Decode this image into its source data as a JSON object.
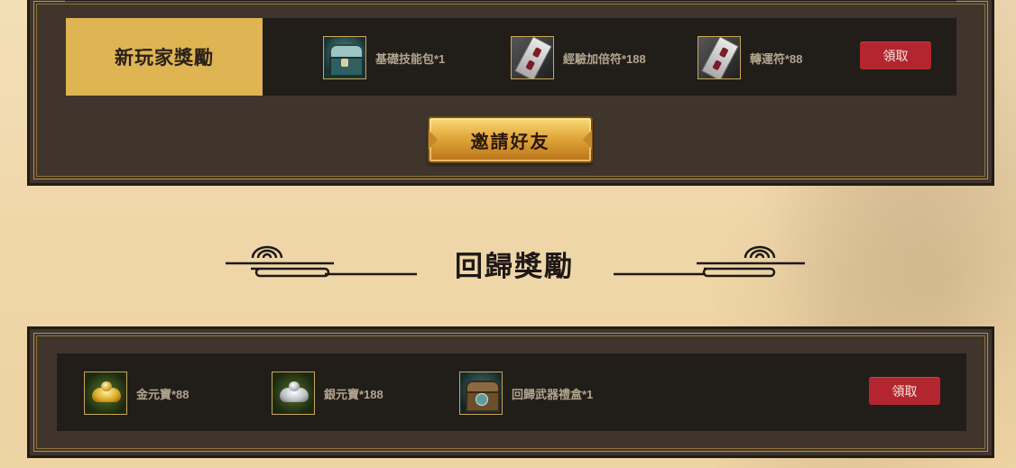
{
  "newplayer_reward": {
    "label": "新玩家獎勵",
    "items": [
      {
        "label": "基礎技能包*1",
        "icon": "skill-chest-icon"
      },
      {
        "label": "經驗加倍符*188",
        "icon": "exp-talisman-icon"
      },
      {
        "label": "轉運符*88",
        "icon": "luck-talisman-icon"
      }
    ],
    "claim_label": "領取"
  },
  "invite": {
    "label": "邀請好友"
  },
  "return_section": {
    "title": "回歸獎勵"
  },
  "return_reward": {
    "items": [
      {
        "label": "金元寶*88",
        "icon": "gold-ingot-icon"
      },
      {
        "label": "銀元寶*188",
        "icon": "silver-ingot-icon"
      },
      {
        "label": "回歸武器禮盒*1",
        "icon": "weapon-giftbox-icon"
      }
    ],
    "claim_label": "領取"
  },
  "colors": {
    "accent_gold": "#dfb452",
    "claim_red": "#b3262f",
    "panel_dark": "#3f352c",
    "background": "#f3dfb7"
  }
}
